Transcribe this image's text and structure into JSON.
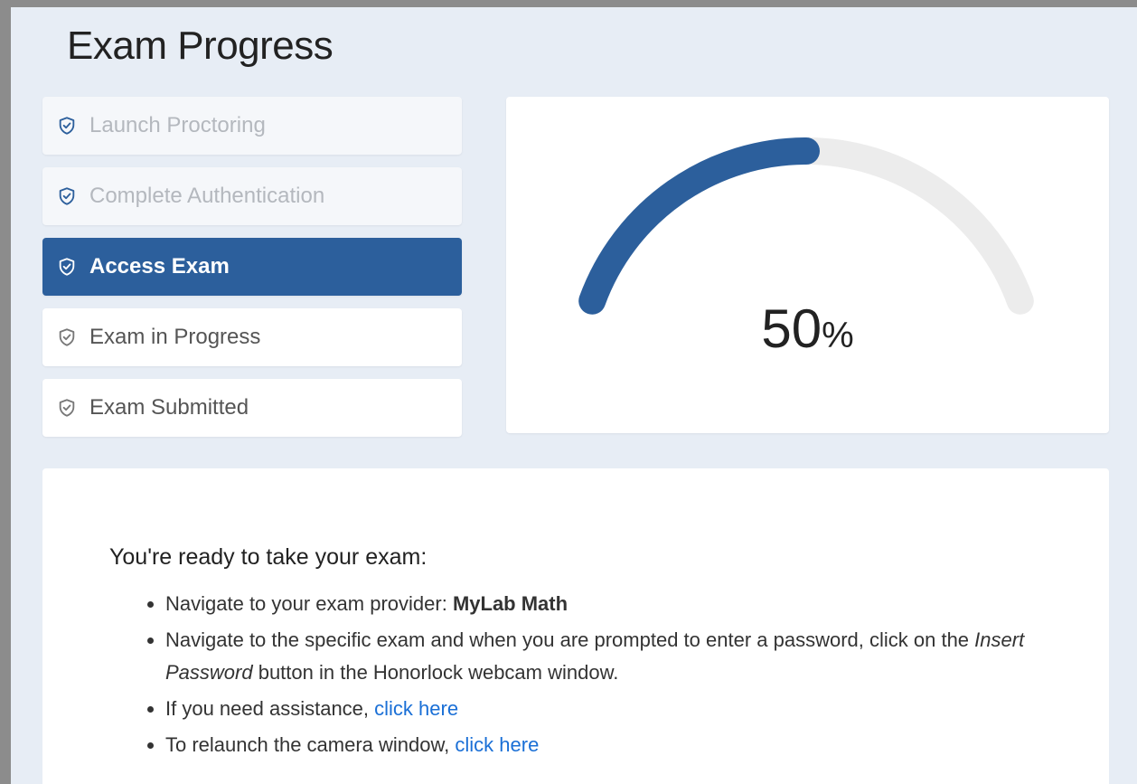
{
  "page": {
    "title": "Exam Progress"
  },
  "steps": [
    {
      "label": "Launch Proctoring",
      "state": "done"
    },
    {
      "label": "Complete Authentication",
      "state": "done"
    },
    {
      "label": "Access Exam",
      "state": "active"
    },
    {
      "label": "Exam in Progress",
      "state": "todo"
    },
    {
      "label": "Exam Submitted",
      "state": "todo"
    }
  ],
  "progress": {
    "value": 50,
    "suffix": "%",
    "fraction": 0.5,
    "fill_color": "#2c5f9c",
    "track_color": "#ececec"
  },
  "info": {
    "heading": "You're ready to take your exam:",
    "items": {
      "i1": {
        "text": "Navigate to your exam provider: ",
        "strong": "MyLab Math"
      },
      "i2": {
        "pre": "Navigate to the specific exam and when you are prompted to enter a password, click on the ",
        "em": "Insert Password",
        "post": " button in the Honorlock webcam window."
      },
      "i3": {
        "text": "If you need assistance, ",
        "link": "click here"
      },
      "i4": {
        "text": "To relaunch the camera window, ",
        "link": "click here"
      }
    }
  }
}
